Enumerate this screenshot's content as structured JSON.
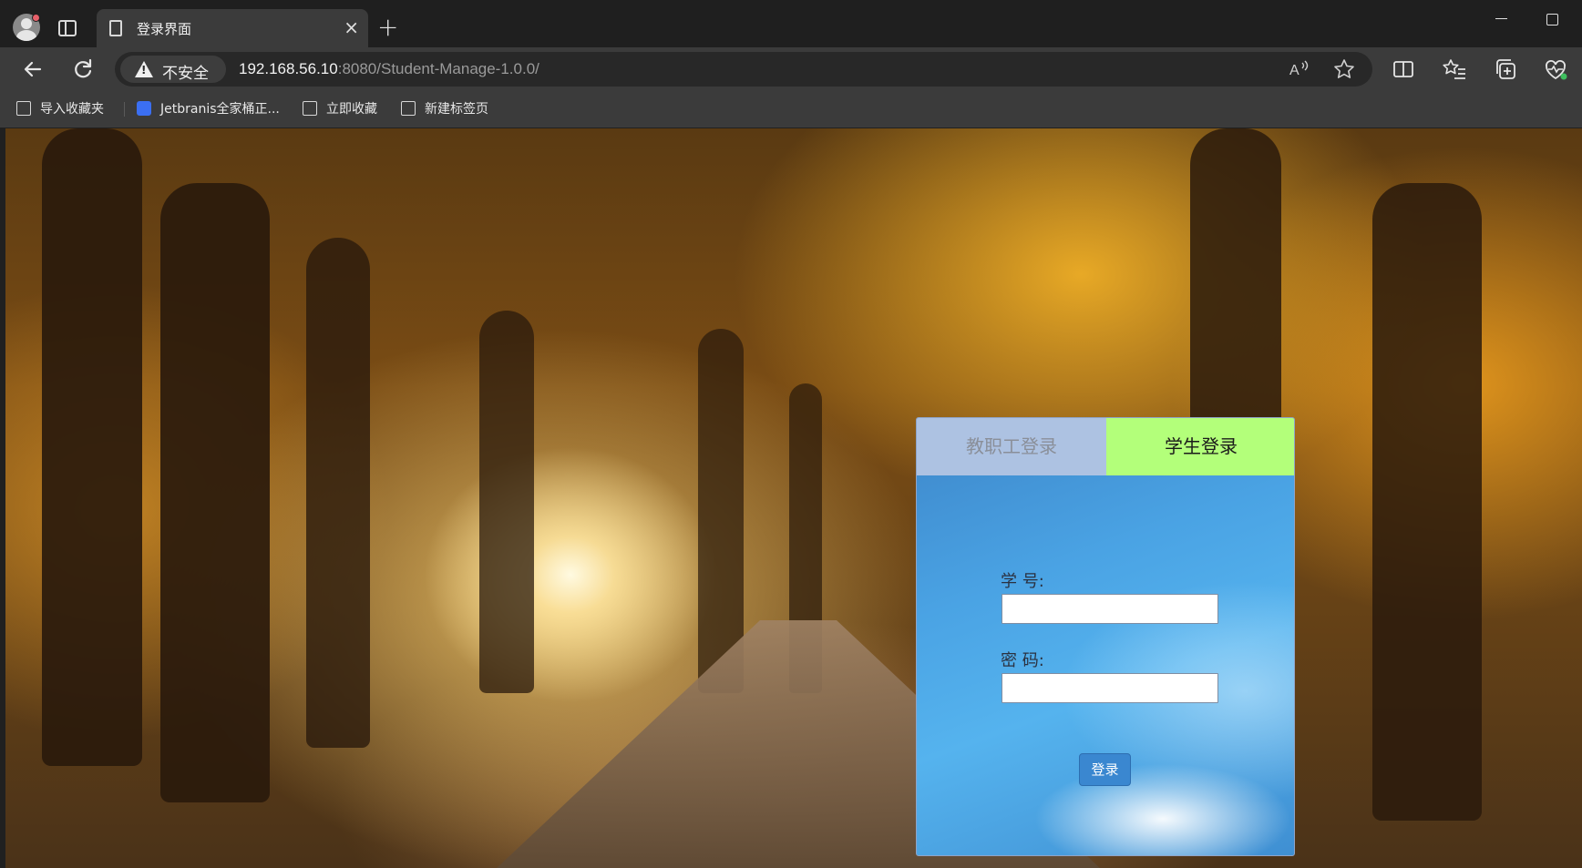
{
  "browser": {
    "tab_title": "登录界面",
    "tab_close": "×",
    "new_tab": "+",
    "security_label": "不安全",
    "url_host": "192.168.56.10",
    "url_rest": ":8080/Student-Manage-1.0.0/",
    "bookmarks": [
      {
        "label": "导入收藏夹",
        "icon": "import-favorites-icon"
      },
      {
        "label": "Jetbranis全家桶正...",
        "icon": "document-icon"
      },
      {
        "label": "立即收藏",
        "icon": "page-icon"
      },
      {
        "label": "新建标签页",
        "icon": "new-tab-page-icon"
      }
    ]
  },
  "login": {
    "tabs": {
      "staff": "教职工登录",
      "student": "学生登录"
    },
    "active_tab": "student",
    "fields": {
      "id_label": "学 号:",
      "id_value": "",
      "password_label": "密 码:",
      "password_value": ""
    },
    "submit_label": "登录",
    "colors": {
      "staff_tab_bg": "#adc2e2",
      "student_tab_bg": "#b3ff7a",
      "button_bg": "#3a87d0"
    }
  }
}
